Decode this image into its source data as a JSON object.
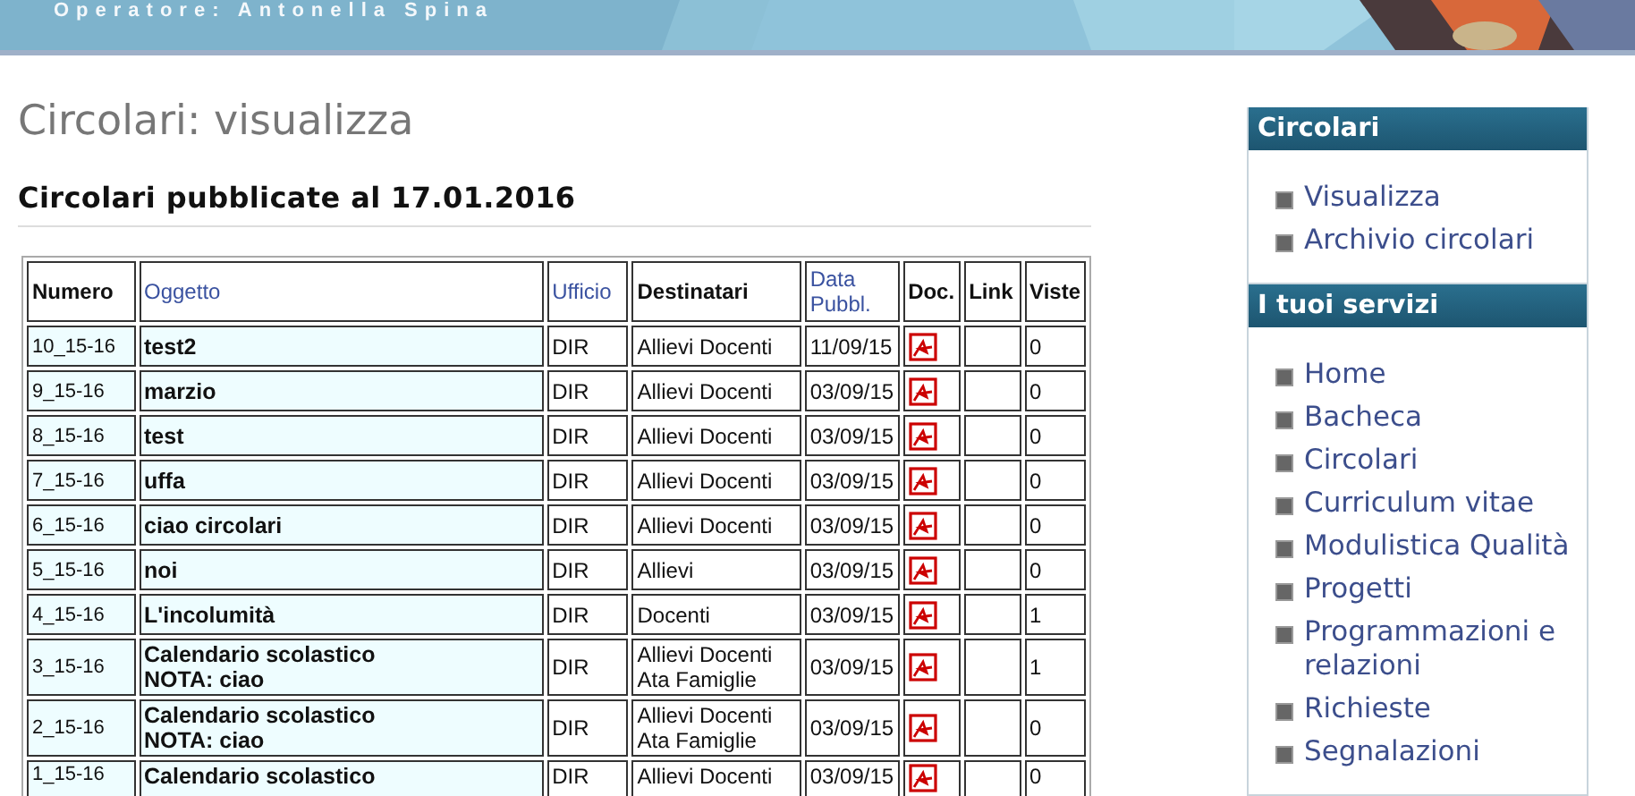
{
  "header": {
    "operator": "Operatore: Antonella Spina"
  },
  "page_title": "Circolari: visualizza",
  "subtitle": "Circolari pubblicate al 17.01.2016",
  "table": {
    "columns": [
      {
        "label": "Numero",
        "sortable": false
      },
      {
        "label": "Oggetto",
        "sortable": true
      },
      {
        "label": "Ufficio",
        "sortable": true
      },
      {
        "label": "Destinatari",
        "sortable": false
      },
      {
        "label": "Data Pubbl.",
        "sortable": true
      },
      {
        "label": "Doc.",
        "sortable": false
      },
      {
        "label": "Link",
        "sortable": false
      },
      {
        "label": "Viste",
        "sortable": false
      }
    ],
    "rows": [
      {
        "numero": "10_15-16",
        "oggetto": [
          "test2"
        ],
        "ufficio": "DIR",
        "destinatari": [
          "Allievi Docenti"
        ],
        "data": "11/09/15",
        "doc": true,
        "viste": "0"
      },
      {
        "numero": "9_15-16",
        "oggetto": [
          "marzio"
        ],
        "ufficio": "DIR",
        "destinatari": [
          "Allievi Docenti"
        ],
        "data": "03/09/15",
        "doc": true,
        "viste": "0"
      },
      {
        "numero": "8_15-16",
        "oggetto": [
          "test"
        ],
        "ufficio": "DIR",
        "destinatari": [
          "Allievi Docenti"
        ],
        "data": "03/09/15",
        "doc": true,
        "viste": "0"
      },
      {
        "numero": "7_15-16",
        "oggetto": [
          "uffa"
        ],
        "ufficio": "DIR",
        "destinatari": [
          "Allievi Docenti"
        ],
        "data": "03/09/15",
        "doc": true,
        "viste": "0"
      },
      {
        "numero": "6_15-16",
        "oggetto": [
          "ciao circolari"
        ],
        "ufficio": "DIR",
        "destinatari": [
          "Allievi Docenti"
        ],
        "data": "03/09/15",
        "doc": true,
        "viste": "0"
      },
      {
        "numero": "5_15-16",
        "oggetto": [
          "noi"
        ],
        "ufficio": "DIR",
        "destinatari": [
          "Allievi"
        ],
        "data": "03/09/15",
        "doc": true,
        "viste": "0"
      },
      {
        "numero": "4_15-16",
        "oggetto": [
          "L'incolumità"
        ],
        "ufficio": "DIR",
        "destinatari": [
          "Docenti"
        ],
        "data": "03/09/15",
        "doc": true,
        "viste": "1"
      },
      {
        "numero": "3_15-16",
        "oggetto": [
          "Calendario scolastico",
          "NOTA: ciao"
        ],
        "ufficio": "DIR",
        "destinatari": [
          "Allievi Docenti",
          "Ata Famiglie"
        ],
        "data": "03/09/15",
        "doc": true,
        "viste": "1"
      },
      {
        "numero": "2_15-16",
        "oggetto": [
          "Calendario scolastico",
          "NOTA: ciao"
        ],
        "ufficio": "DIR",
        "destinatari": [
          "Allievi Docenti",
          "Ata Famiglie"
        ],
        "data": "03/09/15",
        "doc": true,
        "viste": "0"
      },
      {
        "numero": "1_15-16",
        "oggetto": [
          "Calendario scolastico"
        ],
        "ufficio": "DIR",
        "destinatari": [
          "Allievi Docenti"
        ],
        "data": "03/09/15",
        "doc": true,
        "viste": "0"
      }
    ]
  },
  "sidebar": [
    {
      "title": "Circolari",
      "items": [
        {
          "label": "Visualizza"
        },
        {
          "label": "Archivio circolari"
        }
      ]
    },
    {
      "title": "I tuoi servizi",
      "items": [
        {
          "label": "Home"
        },
        {
          "label": "Bacheca"
        },
        {
          "label": "Circolari"
        },
        {
          "label": "Curriculum vitae"
        },
        {
          "label": "Modulistica Qualità"
        },
        {
          "label": "Progetti"
        },
        {
          "label": "Programmazioni e relazioni"
        },
        {
          "label": "Richieste"
        },
        {
          "label": "Segnalazioni"
        }
      ]
    }
  ]
}
